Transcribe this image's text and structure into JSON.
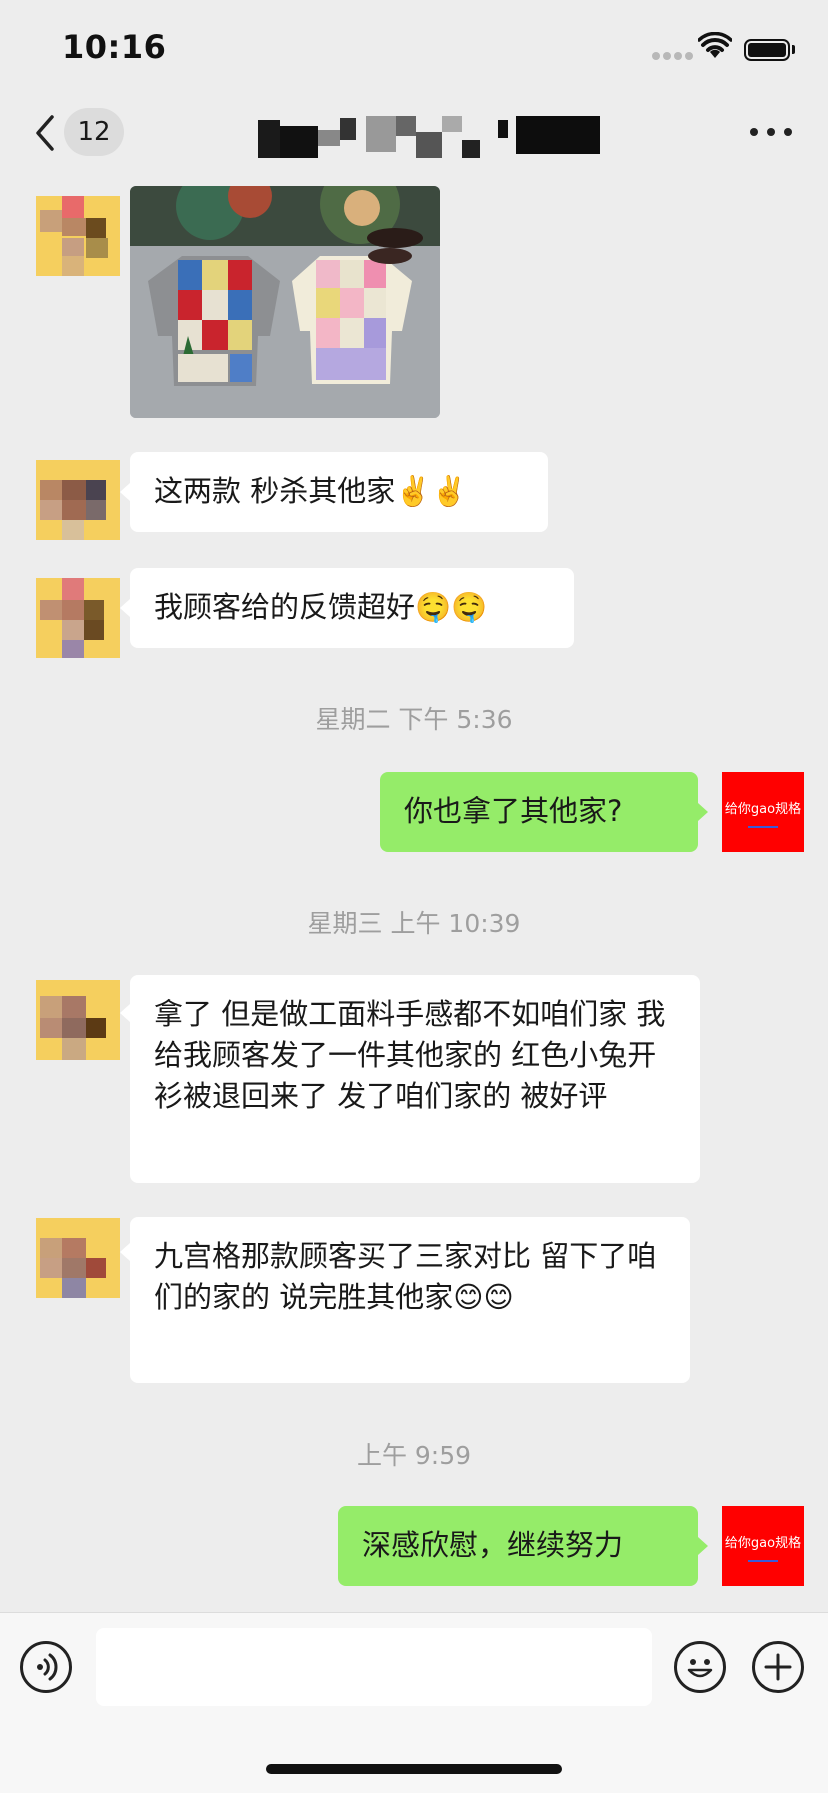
{
  "status_bar": {
    "time": "10:16"
  },
  "nav": {
    "unread_count": "12"
  },
  "my_avatar": {
    "text": "给你gao规格"
  },
  "messages": [
    {
      "side": "left",
      "type": "image"
    },
    {
      "side": "left",
      "type": "text",
      "text": "这两款 秒杀其他家✌️✌️"
    },
    {
      "side": "left",
      "type": "text",
      "text": "我顾客给的反馈超好🤤🤤"
    },
    {
      "side": "right",
      "type": "text",
      "text": "你也拿了其他家?"
    },
    {
      "side": "left",
      "type": "text",
      "text": "拿了 但是做工面料手感都不如咱们家 我给我顾客发了一件其他家的 红色小兔开衫被退回来了 发了咱们家的 被好评"
    },
    {
      "side": "left",
      "type": "text",
      "text": "九宫格那款顾客买了三家对比 留下了咱们的家的 说完胜其他家😊😊"
    },
    {
      "side": "right",
      "type": "text",
      "text": "深感欣慰，继续努力"
    }
  ],
  "timestamps": [
    "星期二 下午 5:36",
    "星期三 上午 10:39",
    "上午 9:59"
  ],
  "input": {
    "value": ""
  },
  "icons": [
    "back-arrow-icon",
    "more-icon",
    "voice-icon",
    "emoji-icon",
    "plus-icon",
    "wifi-icon",
    "battery-icon",
    "signal-icon"
  ],
  "colors": {
    "background": "#ededed",
    "my_bubble": "#95ec69",
    "their_bubble": "#ffffff",
    "my_avatar": "#ff0000"
  }
}
